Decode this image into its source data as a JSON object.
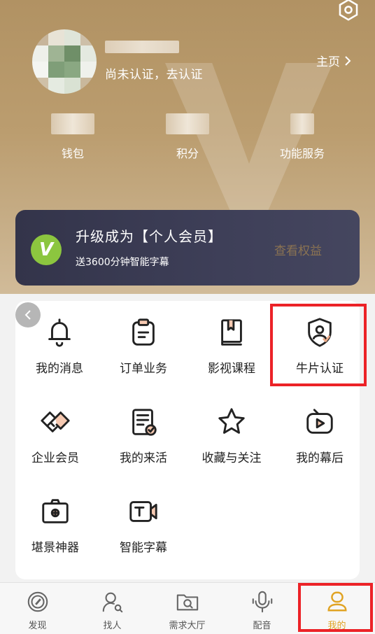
{
  "header": {
    "verify_text": "尚未认证，去认证",
    "homepage_label": "主页"
  },
  "stats": [
    {
      "label": "钱包"
    },
    {
      "label": "积分"
    },
    {
      "label": "功能服务"
    }
  ],
  "vip_banner": {
    "logo_letter": "V",
    "title": "升级成为【个人会员】",
    "subtitle": "送3600分钟智能字幕",
    "action_label": "查看权益"
  },
  "menu": {
    "items": [
      {
        "label": "我的消息",
        "icon": "bell-icon"
      },
      {
        "label": "订单业务",
        "icon": "clipboard-icon"
      },
      {
        "label": "影视课程",
        "icon": "book-icon"
      },
      {
        "label": "牛片认证",
        "icon": "shield-user-icon"
      },
      {
        "label": "企业会员",
        "icon": "handshake-icon"
      },
      {
        "label": "我的来活",
        "icon": "task-check-icon"
      },
      {
        "label": "收藏与关注",
        "icon": "star-icon"
      },
      {
        "label": "我的幕后",
        "icon": "tv-play-icon"
      },
      {
        "label": "堪景神器",
        "icon": "camera-frame-icon"
      },
      {
        "label": "智能字幕",
        "icon": "subtitle-camera-icon"
      }
    ]
  },
  "tabbar": {
    "tabs": [
      {
        "label": "发现",
        "icon": "compass-icon"
      },
      {
        "label": "找人",
        "icon": "person-search-icon"
      },
      {
        "label": "需求大厅",
        "icon": "folder-search-icon"
      },
      {
        "label": "配音",
        "icon": "microphone-icon"
      },
      {
        "label": "我的",
        "icon": "profile-icon",
        "active": true
      }
    ]
  },
  "colors": {
    "accent": "#e0a323",
    "header_gold": "#b8996a",
    "vip_bg": "#3a3b52",
    "vip_logo": "#8cc63f",
    "highlight": "#ec2227"
  }
}
